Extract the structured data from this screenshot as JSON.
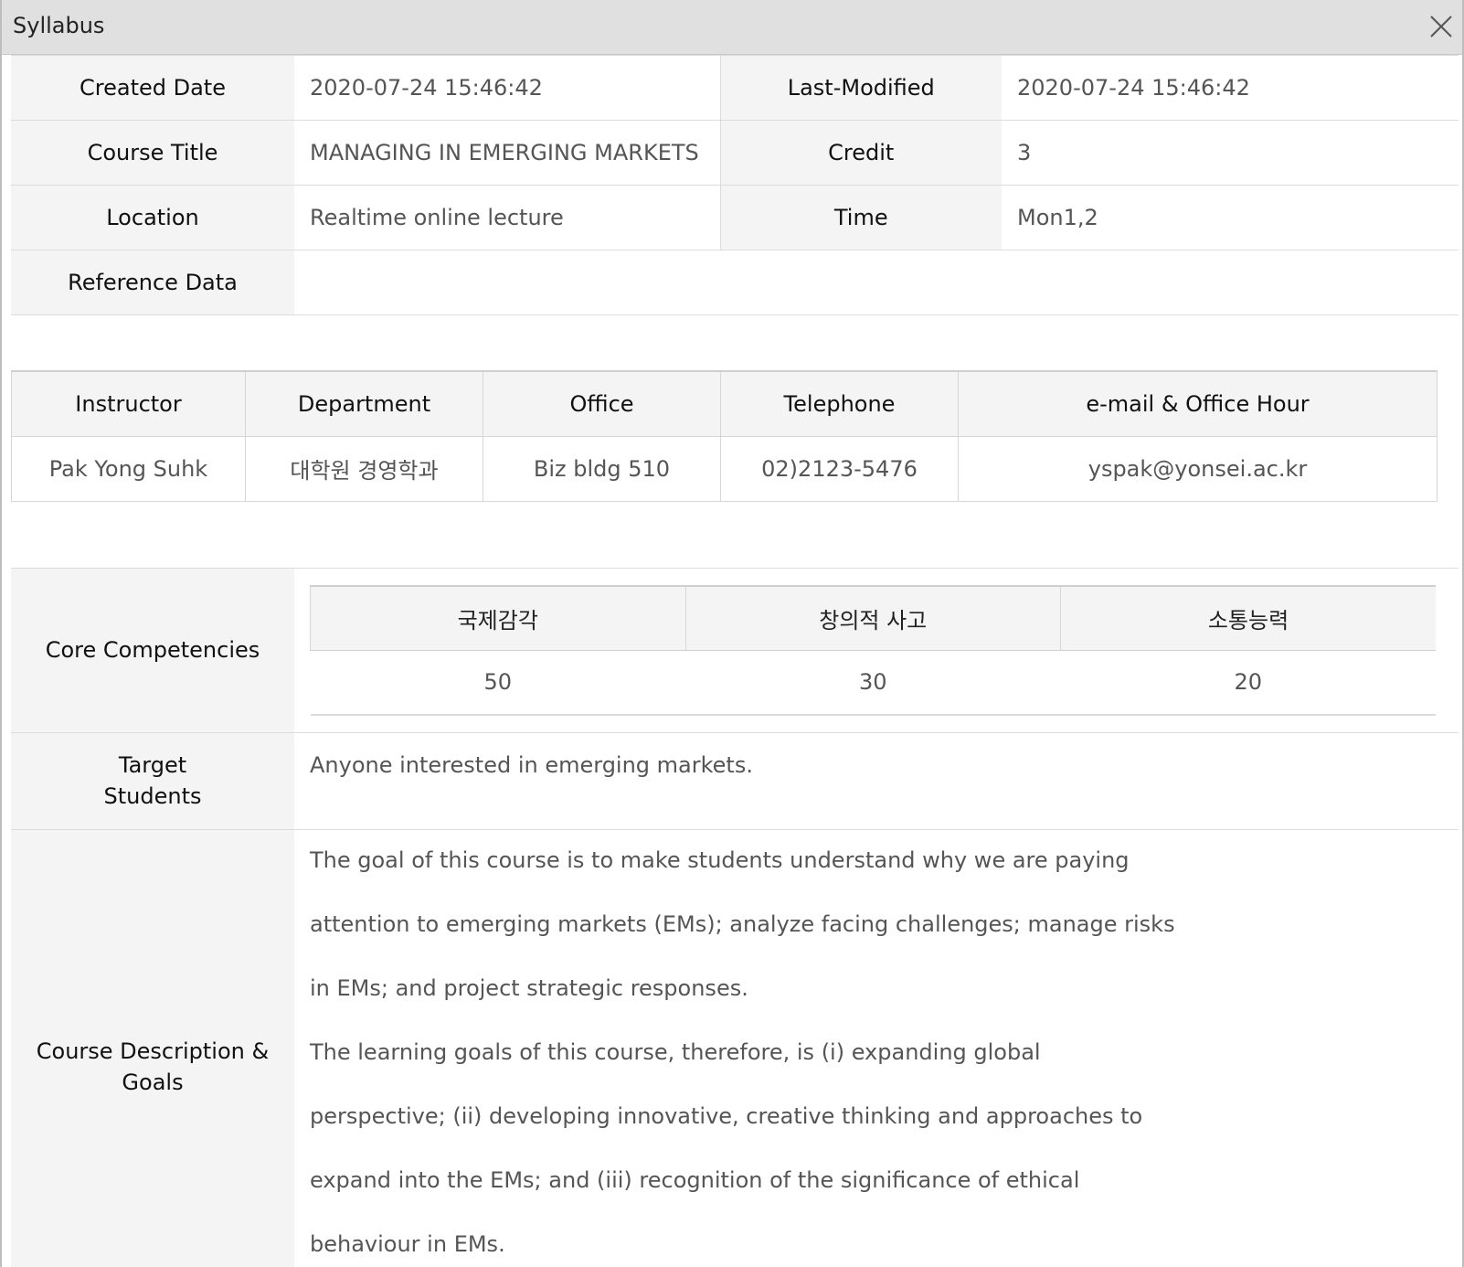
{
  "window": {
    "title": "Syllabus"
  },
  "info": {
    "created_date_label": "Created Date",
    "created_date": "2020-07-24 15:46:42",
    "last_modified_label": "Last-Modified",
    "last_modified": "2020-07-24 15:46:42",
    "course_title_label": "Course Title",
    "course_title": "MANAGING IN EMERGING MARKETS",
    "credit_label": "Credit",
    "credit": "3",
    "location_label": "Location",
    "location": "Realtime online lecture",
    "time_label": "Time",
    "time": "Mon1,2",
    "reference_label": "Reference Data",
    "reference": ""
  },
  "instructor_table": {
    "headers": [
      "Instructor",
      "Department",
      "Office",
      "Telephone",
      "e-mail & Office Hour"
    ],
    "row": [
      "Pak Yong Suhk",
      "대학원 경영학과",
      "Biz bldg 510",
      "02)2123-5476",
      "yspak@yonsei.ac.kr"
    ]
  },
  "core": {
    "label": "Core Competencies",
    "headers": [
      "국제감각",
      "창의적 사고",
      "소통능력"
    ],
    "values": [
      "50",
      "30",
      "20"
    ]
  },
  "target": {
    "label_line1": "Target",
    "label_line2": "Students",
    "value": "Anyone interested in emerging markets."
  },
  "description": {
    "label_line1": "Course Description &",
    "label_line2": "Goals",
    "lines": [
      "The goal of this course is to make students understand why we are paying",
      "attention to emerging markets (EMs); analyze facing challenges; manage risks",
      "in EMs; and project strategic responses.",
      "The learning goals of this course, therefore, is (i) expanding global",
      "perspective; (ii) developing innovative, creative thinking and approaches to",
      "expand into the EMs; and (iii) recognition of the significance of ethical",
      "behaviour in EMs."
    ]
  }
}
